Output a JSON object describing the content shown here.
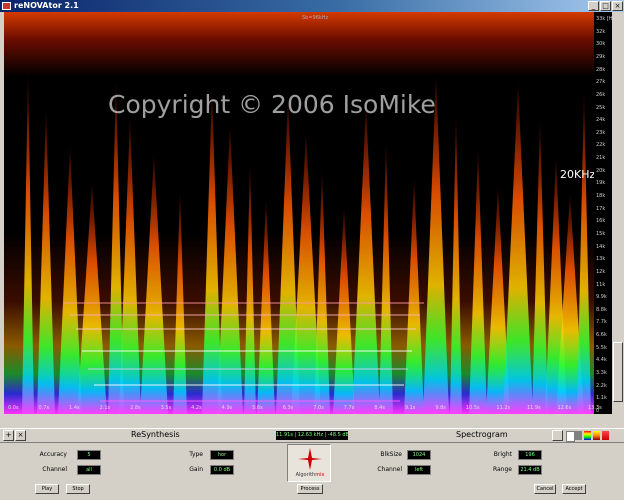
{
  "window": {
    "title": "reNOVAtor 2.1",
    "buttons": {
      "minimize": "_",
      "maximize": "□",
      "close": "×"
    }
  },
  "spectrogram": {
    "top_label": "Sb=96kHz",
    "watermark": "Copyright © 2006 IsoMike",
    "marker": "20KHz",
    "y_ticks": [
      "33k [Hz]",
      "32k",
      "30k",
      "29k",
      "28k",
      "27k",
      "26k",
      "25k",
      "24k",
      "23k",
      "22k",
      "21k",
      "20k",
      "19k",
      "18k",
      "17k",
      "16k",
      "15k",
      "14k",
      "13k",
      "12k",
      "11k",
      "9.9k",
      "8.8k",
      "7.7k",
      "6.6k",
      "5.5k",
      "4.4k",
      "3.3k",
      "2.2k",
      "1.1k",
      "0"
    ],
    "x_ticks": [
      "0.0s",
      "0.7s",
      "1.4s",
      "2.1s",
      "2.8s",
      "3.5s",
      "4.2s",
      "4.9s",
      "5.6s",
      "6.3s",
      "7.0s",
      "7.7s",
      "8.4s",
      "9.1s",
      "9.8s",
      "10.5s",
      "11.2s",
      "11.9s",
      "12.6s",
      "13.3s"
    ]
  },
  "toolbar": {
    "resynthesis_label": "ReSynthesis",
    "spectrogram_label": "Spectrogram",
    "status": "11.91s | 12.63 kHz | -48.5 dB",
    "expand": "+",
    "close": "×"
  },
  "resynthesis": {
    "accuracy_label": "Accuracy",
    "accuracy": "5",
    "channel_label": "Channel",
    "channel": "all",
    "type_label": "Type",
    "type": "hor",
    "gain_label": "Gain",
    "gain": "0.0 dB"
  },
  "spectro_settings": {
    "blksize_label": "BlkSize",
    "blksize": "1024",
    "channel_label": "Channel",
    "channel": "left",
    "bright_label": "Bright",
    "bright": "196",
    "range_label": "Range",
    "range": "21.4 dB"
  },
  "logo": {
    "text_a": "Algorith",
    "text_b": "mix"
  },
  "buttons": {
    "play": "Play",
    "stop": "Stop",
    "process": "Process",
    "cancel": "Cancel",
    "accept": "Accept"
  },
  "colors": {
    "title_start": "#0a246a",
    "title_end": "#a6caf0",
    "field_text": "#7fff7f",
    "panel": "#d4d0c8"
  }
}
